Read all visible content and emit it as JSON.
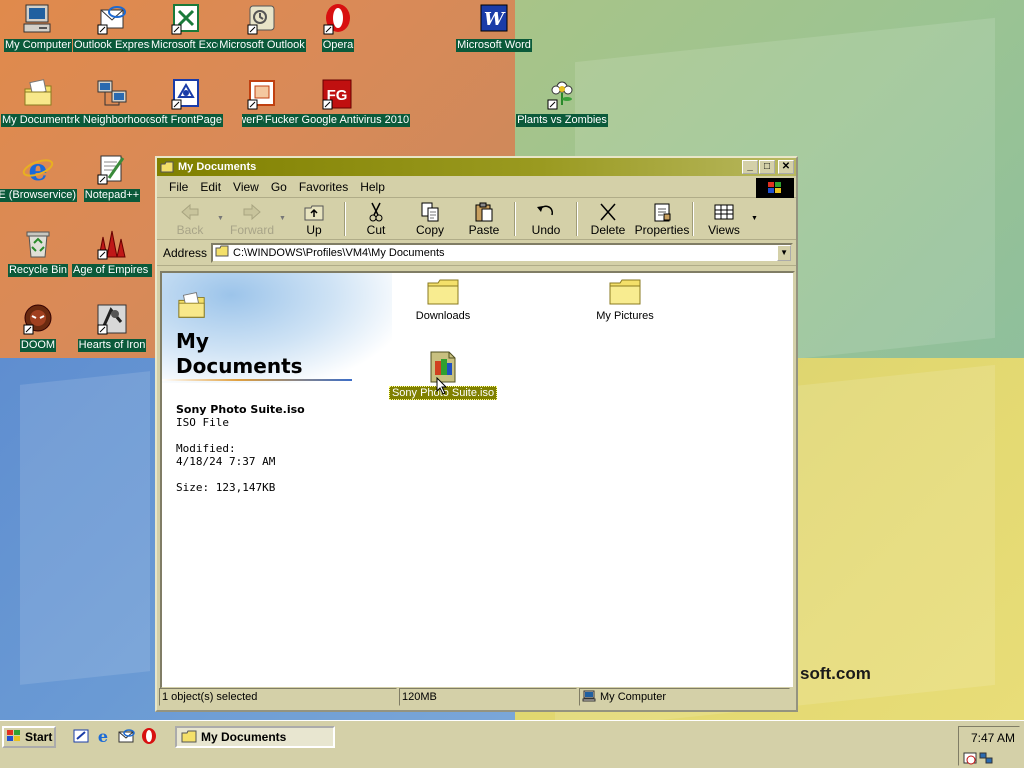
{
  "desktop": {
    "icons": [
      {
        "label": "My Computer",
        "icon": "computer-icon"
      },
      {
        "label": "Outlook Express",
        "icon": "outlook-express-icon"
      },
      {
        "label": "Microsoft Excel",
        "icon": "excel-icon"
      },
      {
        "label": "Microsoft Outlook",
        "icon": "outlook-icon"
      },
      {
        "label": "Opera",
        "icon": "opera-icon"
      },
      {
        "label": "Microsoft Word",
        "icon": "word-icon"
      },
      {
        "label": "My Documents",
        "icon": "documents-folder-icon"
      },
      {
        "label": "Network Neighborhood",
        "icon": "network-icon"
      },
      {
        "label": "Microsoft FrontPage",
        "icon": "frontpage-icon"
      },
      {
        "label": "Microsoft PowerPoint",
        "icon": "powerpoint-icon"
      },
      {
        "label": "Fucker Google Antivirus 2010",
        "icon": "antivirus-icon"
      },
      {
        "label": "Plants vs Zombies",
        "icon": "plants-vs-zombies-icon"
      },
      {
        "label": "IE (Browservice)",
        "icon": "internet-explorer-icon"
      },
      {
        "label": "Notepad++",
        "icon": "notepad-icon"
      },
      {
        "label": "Recycle Bin",
        "icon": "recycle-bin-icon"
      },
      {
        "label": "Age of Empires II",
        "icon": "age-of-empires-icon"
      },
      {
        "label": "DOOM",
        "icon": "doom-icon"
      },
      {
        "label": "Hearts of Iron",
        "icon": "hearts-of-iron-icon"
      }
    ],
    "wallpaper_text": "soft.com"
  },
  "window": {
    "title": "My Documents",
    "menu": [
      "File",
      "Edit",
      "View",
      "Go",
      "Favorites",
      "Help"
    ],
    "toolbar": {
      "back": "Back",
      "forward": "Forward",
      "up": "Up",
      "cut": "Cut",
      "copy": "Copy",
      "paste": "Paste",
      "undo": "Undo",
      "delete": "Delete",
      "properties": "Properties",
      "views": "Views"
    },
    "address": {
      "label": "Address",
      "value": "C:\\WINDOWS\\Profiles\\VM4\\My Documents"
    },
    "webview": {
      "title_line1": "My",
      "title_line2": "Documents",
      "file_name": "Sony Photo Suite.iso",
      "file_type": "ISO File",
      "modified_label": "Modified:",
      "modified_value": "4/18/24 7:37 AM",
      "size": "Size: 123,147KB"
    },
    "files": [
      {
        "label": "Downloads",
        "type": "folder"
      },
      {
        "label": "My Pictures",
        "type": "folder"
      },
      {
        "label": "Sony Photo Suite.iso",
        "type": "iso",
        "selected": true
      }
    ],
    "status": {
      "selection": "1 object(s) selected",
      "size": "120MB",
      "zone": "My Computer"
    }
  },
  "taskbar": {
    "start": "Start",
    "task": "My Documents",
    "clock": "7:47 AM"
  },
  "colors": {
    "titlebar": "#808000",
    "desktop_label_bg": "#0b5a3a",
    "selection": "#808000"
  }
}
